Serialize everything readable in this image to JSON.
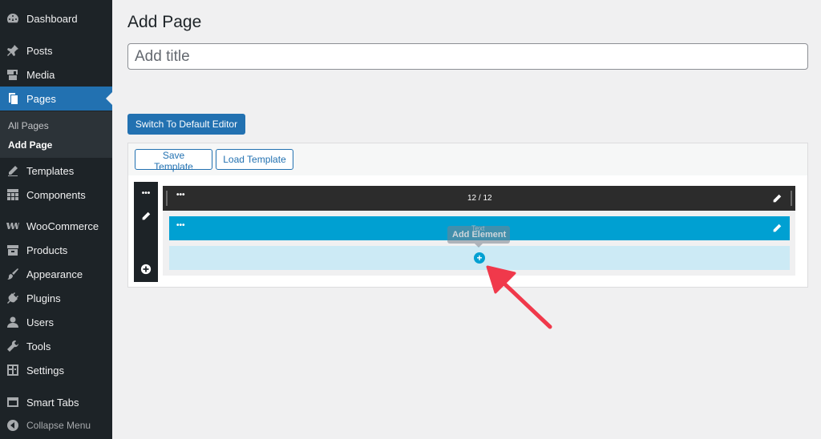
{
  "sidebar": {
    "items": [
      {
        "label": "Dashboard",
        "icon": "dashboard-icon"
      },
      {
        "label": "Posts",
        "icon": "pin-icon"
      },
      {
        "label": "Media",
        "icon": "media-icon"
      },
      {
        "label": "Pages",
        "icon": "pages-icon",
        "active": true
      },
      {
        "label": "Templates",
        "icon": "pencil-icon"
      },
      {
        "label": "Components",
        "icon": "grid-icon"
      },
      {
        "label": "WooCommerce",
        "icon": "woo-icon"
      },
      {
        "label": "Products",
        "icon": "archive-icon"
      },
      {
        "label": "Appearance",
        "icon": "brush-icon"
      },
      {
        "label": "Plugins",
        "icon": "plug-icon"
      },
      {
        "label": "Users",
        "icon": "user-icon"
      },
      {
        "label": "Tools",
        "icon": "wrench-icon"
      },
      {
        "label": "Settings",
        "icon": "settings-icon"
      },
      {
        "label": "Smart Tabs",
        "icon": "tabs-icon"
      }
    ],
    "submenu": [
      {
        "label": "All Pages"
      },
      {
        "label": "Add Page",
        "current": true
      }
    ],
    "collapse_label": "Collapse Menu"
  },
  "main": {
    "title": "Add Page",
    "title_placeholder": "Add title",
    "switch_editor_label": "Switch To Default Editor"
  },
  "builder": {
    "save_template_label": "Save Template",
    "load_template_label": "Load Template",
    "row_dots": "•••",
    "column_ratio": "12 / 12",
    "text_element_dots": "•••",
    "text_ghost_label": "Text",
    "add_element_tooltip": "Add Element",
    "add_symbol": "+"
  },
  "colors": {
    "sidebar_bg": "#1d2327",
    "accent": "#2271b1",
    "element_blue": "#00a0d2",
    "drop_zone": "#cceaf5",
    "arrow_red": "#f0394b"
  }
}
